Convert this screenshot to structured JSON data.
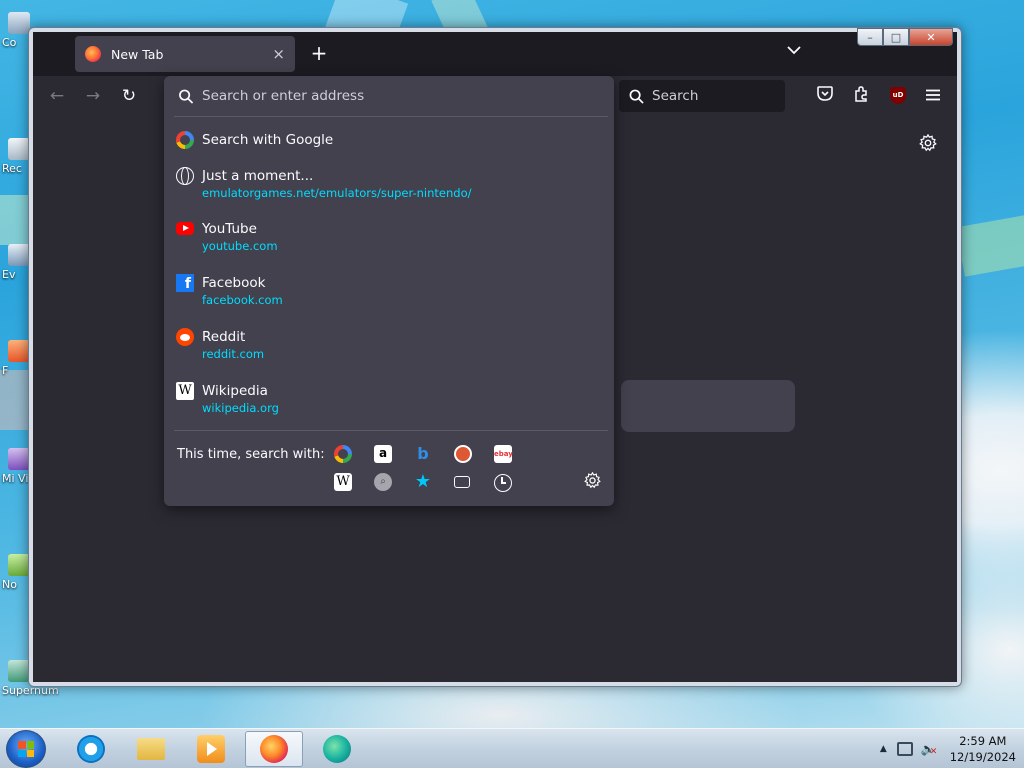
{
  "desktop": {
    "icons": [
      {
        "label": "Co"
      },
      {
        "label": "Rec"
      },
      {
        "label": "Ev"
      },
      {
        "label": "F"
      },
      {
        "label": "Mi\nVisu"
      },
      {
        "label": "No"
      },
      {
        "label": "Supernum"
      }
    ]
  },
  "browser": {
    "tab": {
      "title": "New Tab",
      "close": "×"
    },
    "new_tab_label": "+",
    "list_tabs_icon": "chevron-down-icon",
    "window_controls": {
      "minimize": "–",
      "maximize": "□",
      "close": "✕"
    },
    "nav": {
      "back": "←",
      "forward": "→",
      "reload": "↻",
      "search_placeholder": "Search",
      "ublock_label": "uD"
    },
    "urlbar": {
      "placeholder": "Search or enter address",
      "results": [
        {
          "icon": "google-icon",
          "title": "Search with Google",
          "url": ""
        },
        {
          "icon": "globe-icon",
          "title": "Just a moment...",
          "url": "emulatorgames.net/emulators/super-nintendo/"
        },
        {
          "icon": "youtube-icon",
          "title": "YouTube",
          "url": "youtube.com"
        },
        {
          "icon": "facebook-icon",
          "title": "Facebook",
          "url": "facebook.com"
        },
        {
          "icon": "reddit-icon",
          "title": "Reddit",
          "url": "reddit.com"
        },
        {
          "icon": "wikipedia-icon",
          "title": "Wikipedia",
          "url": "wikipedia.org"
        }
      ],
      "one_off_label": "This time, search with:",
      "engines_row1": [
        "google",
        "amazon",
        "bing",
        "duckduckgo",
        "ebay"
      ],
      "engines_row2": [
        "wikipedia",
        "search",
        "bookmarks",
        "tabs",
        "history"
      ]
    }
  },
  "taskbar": {
    "clock_time": "2:59 AM",
    "clock_date": "12/19/2024"
  },
  "colors": {
    "url_text": "#00ddff",
    "panel": "#42414d",
    "toolbar": "#2b2a33",
    "tabstrip": "#1c1b22"
  }
}
